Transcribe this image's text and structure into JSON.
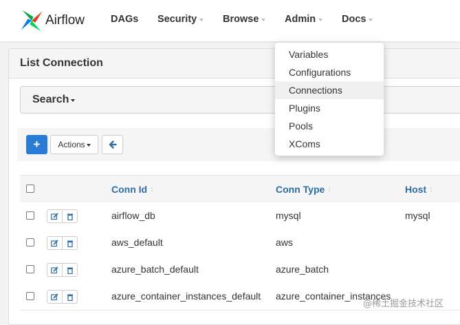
{
  "brand": {
    "name": "Airflow",
    "logo_colors": [
      "#017cee",
      "#00ad46",
      "#e43921",
      "#04d659"
    ]
  },
  "nav": {
    "items": [
      {
        "label": "DAGs",
        "has_caret": false
      },
      {
        "label": "Security",
        "has_caret": true
      },
      {
        "label": "Browse",
        "has_caret": true
      },
      {
        "label": "Admin",
        "has_caret": true
      },
      {
        "label": "Docs",
        "has_caret": true
      }
    ]
  },
  "admin_menu": {
    "items": [
      "Variables",
      "Configurations",
      "Connections",
      "Plugins",
      "Pools",
      "XComs"
    ],
    "hovered": "Connections"
  },
  "panel": {
    "title": "List Connection"
  },
  "search": {
    "label": "Search"
  },
  "toolbar": {
    "add_label": "+",
    "actions_label": "Actions",
    "back_icon": "arrow-left-icon"
  },
  "table": {
    "columns": [
      "Conn Id",
      "Conn Type",
      "Host"
    ],
    "rows": [
      {
        "conn_id": "airflow_db",
        "conn_type": "mysql",
        "host": "mysql"
      },
      {
        "conn_id": "aws_default",
        "conn_type": "aws",
        "host": ""
      },
      {
        "conn_id": "azure_batch_default",
        "conn_type": "azure_batch",
        "host": ""
      },
      {
        "conn_id": "azure_container_instances_default",
        "conn_type": "azure_container_instances",
        "host": ""
      }
    ]
  },
  "watermark": "@稀土掘金技术社区",
  "colors": {
    "primary_button": "#2a7bd5",
    "header_link": "#2e6da4"
  }
}
